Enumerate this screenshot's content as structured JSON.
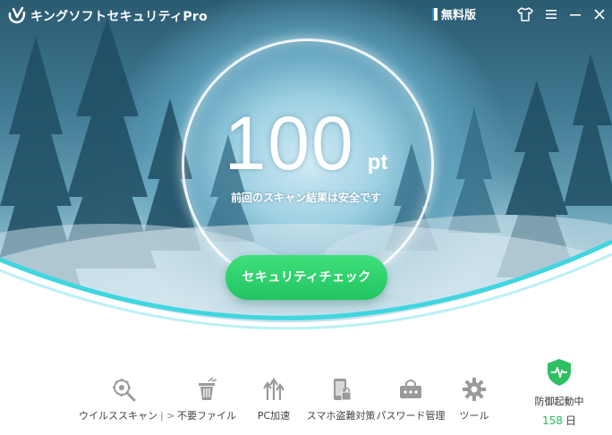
{
  "app": {
    "title": "キングソフトセキュリティPro",
    "edition": "無料版"
  },
  "window": {
    "skin_icon": "tshirt-icon",
    "menu_icon": "hamburger-icon",
    "minimize_icon": "minimize-icon",
    "close_icon": "close-icon"
  },
  "score": {
    "value": "100",
    "unit": "pt",
    "status": "前回のスキャン結果は安全です"
  },
  "check_button": {
    "label": "セキュリティチェック"
  },
  "tools": [
    {
      "label": "ウイルススキャン",
      "icon": "virus-scan-icon",
      "chevron": "|  >"
    },
    {
      "label": "不要ファイル",
      "icon": "trash-icon"
    },
    {
      "label": "PC加速",
      "icon": "speedup-icon"
    },
    {
      "label": "スマホ盗難対策",
      "icon": "phone-lock-icon"
    },
    {
      "label": "パスワード管理",
      "icon": "password-icon"
    },
    {
      "label": "ツール",
      "icon": "gear-icon"
    }
  ],
  "defense": {
    "label": "防御起動中",
    "days": "158",
    "days_unit": "日",
    "icon": "shield-pulse-icon"
  },
  "colors": {
    "accent_green": "#22c462",
    "days_green": "#2bb55e",
    "wave_cyan": "#3fd6e0",
    "shield_green": "#2fbf63"
  }
}
